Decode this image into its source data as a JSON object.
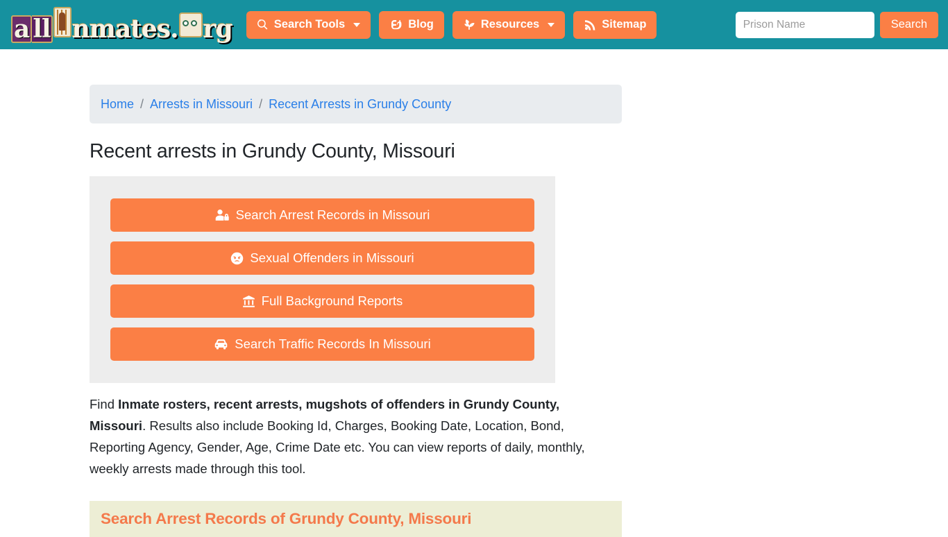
{
  "header": {
    "logo": {
      "name": "allinmates.org",
      "part_a": "a",
      "part_ll": "ll",
      "part_rest": "nmates",
      "part_dot": ".",
      "part_rg": "rg"
    },
    "nav": [
      {
        "label": "Search Tools",
        "icon": "magnifier-icon",
        "has_caret": true
      },
      {
        "label": "Blog",
        "icon": "blogger-icon",
        "has_caret": false
      },
      {
        "label": "Resources",
        "icon": "seedling-icon",
        "has_caret": true
      },
      {
        "label": "Sitemap",
        "icon": "rss-icon",
        "has_caret": false
      }
    ],
    "search": {
      "placeholder": "Prison Name",
      "value": "",
      "submit_label": "Search"
    }
  },
  "breadcrumb": {
    "items": [
      "Home",
      "Arrests in Missouri",
      "Recent Arrests in Grundy County"
    ],
    "separator": "/"
  },
  "main": {
    "page_title": "Recent arrests in Grundy County, Missouri",
    "action_buttons": [
      {
        "label": "Search Arrest Records in Missouri",
        "icon": "user-lock-icon"
      },
      {
        "label": "Sexual Offenders in Missouri",
        "icon": "angry-face-icon"
      },
      {
        "label": "Full Background Reports",
        "icon": "landmark-icon"
      },
      {
        "label": "Search Traffic Records In Missouri",
        "icon": "car-icon"
      }
    ],
    "intro": {
      "lead": "Find ",
      "strong": "Inmate rosters, recent arrests, mugshots of offenders in Grundy County, Missouri",
      "rest": ". Results also include Booking Id, Charges, Booking Date, Location, Bond, Reporting Agency, Gender, Age, Crime Date etc. You can view reports of daily, monthly, weekly arrests made through this tool."
    },
    "section_heading": "Search Arrest Records of Grundy County, Missouri"
  },
  "colors": {
    "header_teal": "#16919f",
    "accent_orange": "#fb7f45",
    "panel_gray": "#ededed",
    "breadcrumb_gray": "#e9ecef",
    "band_cream": "#edeed5",
    "link_blue": "#2a7fe8",
    "heading_orange": "#f4794b"
  }
}
